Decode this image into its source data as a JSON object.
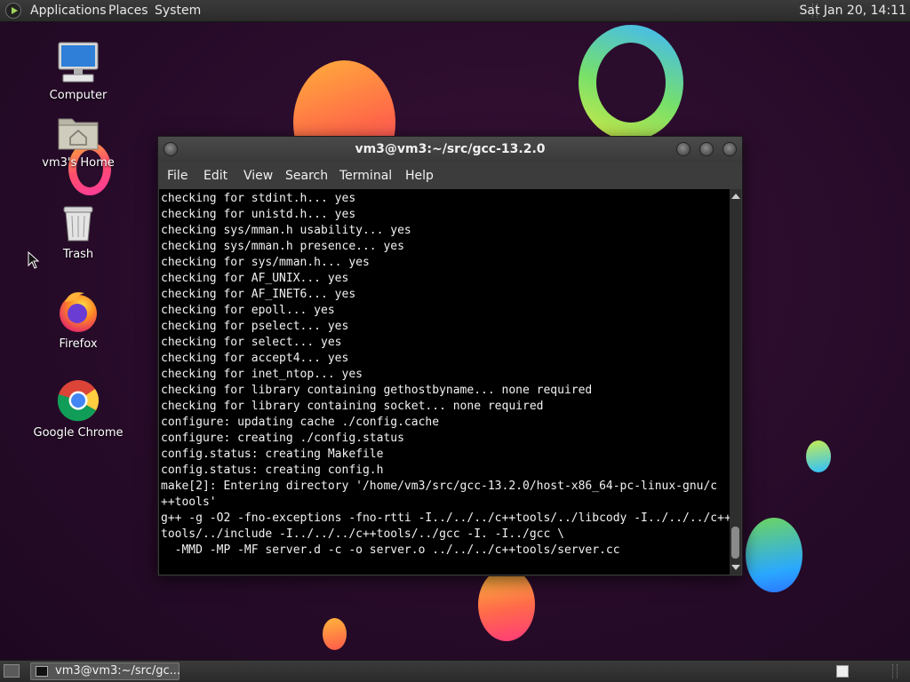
{
  "top_panel": {
    "menus": [
      "Applications",
      "Places",
      "System"
    ],
    "clock": "Sat Jan 20, 14:11"
  },
  "desktop": {
    "icons": [
      {
        "label": "Computer",
        "icon": "computer-icon"
      },
      {
        "label": "vm3's Home",
        "icon": "home-folder-icon"
      },
      {
        "label": "Trash",
        "icon": "trash-icon"
      },
      {
        "label": "Firefox",
        "icon": "firefox-icon"
      },
      {
        "label": "Google Chrome",
        "icon": "chrome-icon"
      }
    ]
  },
  "terminal": {
    "title": "vm3@vm3:~/src/gcc-13.2.0",
    "menu": [
      "File",
      "Edit",
      "View",
      "Search",
      "Terminal",
      "Help"
    ],
    "lines": [
      "checking for stdint.h... yes",
      "checking for unistd.h... yes",
      "checking sys/mman.h usability... yes",
      "checking sys/mman.h presence... yes",
      "checking for sys/mman.h... yes",
      "checking for AF_UNIX... yes",
      "checking for AF_INET6... yes",
      "checking for epoll... yes",
      "checking for pselect... yes",
      "checking for select... yes",
      "checking for accept4... yes",
      "checking for inet_ntop... yes",
      "checking for library containing gethostbyname... none required",
      "checking for library containing socket... none required",
      "configure: updating cache ./config.cache",
      "configure: creating ./config.status",
      "config.status: creating Makefile",
      "config.status: creating config.h",
      "make[2]: Entering directory '/home/vm3/src/gcc-13.2.0/host-x86_64-pc-linux-gnu/c",
      "++tools'",
      "g++ -g -O2 -fno-exceptions -fno-rtti -I../../../c++tools/../libcody -I../../../c++",
      "tools/../include -I../../../c++tools/../gcc -I. -I../gcc \\",
      "  -MMD -MP -MF server.d -c -o server.o ../../../c++tools/server.cc"
    ]
  },
  "bottom_panel": {
    "task_label": "vm3@vm3:~/src/gc..."
  },
  "colors": {
    "terminal_bg": "#000000",
    "terminal_fg": "#f2f2f2",
    "panel_bg": "#2f2f2f"
  }
}
